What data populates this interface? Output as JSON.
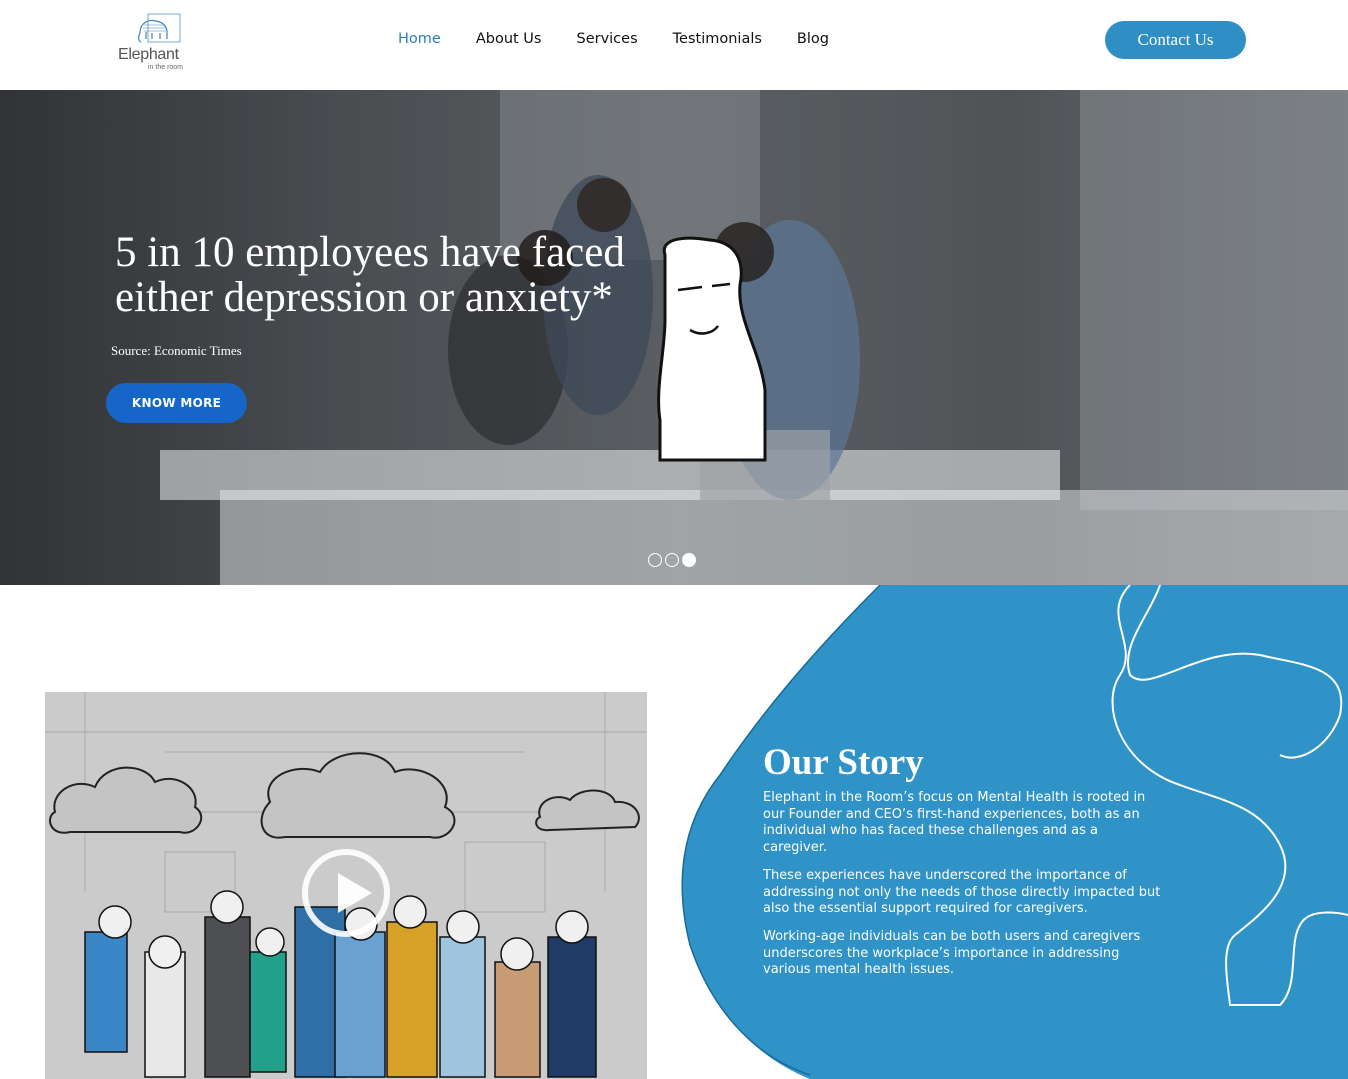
{
  "header": {
    "logo": {
      "brand": "Elephant",
      "tagline": "in the room",
      "icon": "elephant-logo-icon"
    },
    "nav": [
      {
        "label": "Home",
        "active": true
      },
      {
        "label": "About Us",
        "active": false
      },
      {
        "label": "Services",
        "active": false
      },
      {
        "label": "Testimonials",
        "active": false
      },
      {
        "label": "Blog",
        "active": false
      }
    ],
    "contact_label": "Contact Us"
  },
  "hero": {
    "title": "5 in 10 employees have faced either depression or anxiety*",
    "source": "Source: Economic Times",
    "cta_label": "KNOW MORE",
    "slides": 3,
    "active_slide": 3
  },
  "video": {
    "play_icon": "play-icon"
  },
  "story": {
    "title": "Our Story",
    "paragraphs": [
      "Elephant in the Room’s focus on Mental Health is rooted in our Founder and CEO’s first-hand experiences, both as an individual who has faced these challenges and as a caregiver.",
      "These experiences have underscored the importance of addressing not only the needs of those directly impacted but also the essential support required for caregivers.",
      "Working-age individuals can be both users and caregivers underscores the workplace’s importance in addressing various mental health issues."
    ]
  },
  "colors": {
    "accent": "#2f8fc5",
    "cta": "#1566c8",
    "nav_active": "#2e7fb8"
  }
}
